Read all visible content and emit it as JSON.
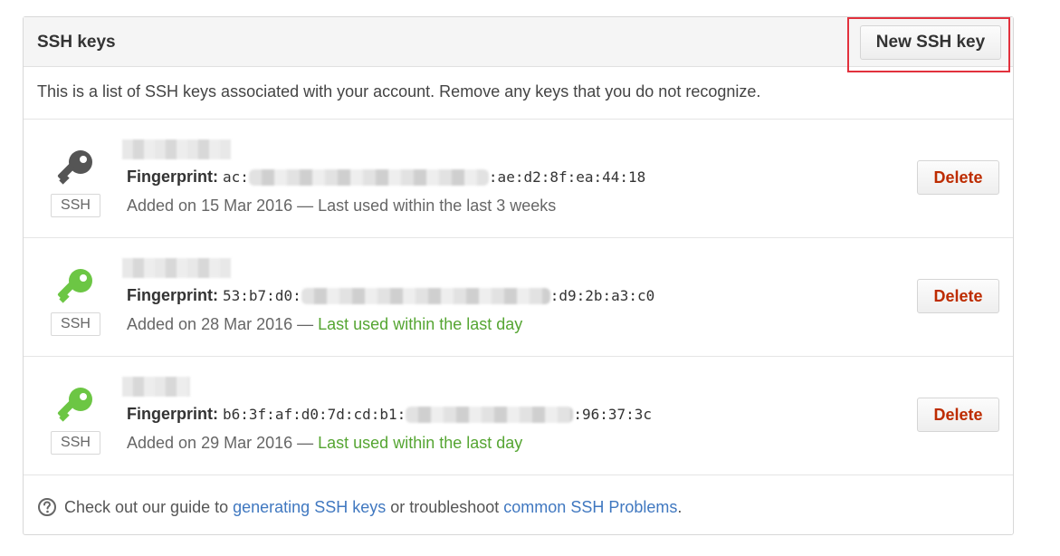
{
  "header": {
    "title": "SSH keys",
    "new_key_label": "New SSH key"
  },
  "intro": "This is a list of SSH keys associated with your account. Remove any keys that you do not recognize.",
  "keys": [
    {
      "badge": "SSH",
      "icon": "key-icon",
      "icon_color": "#555555",
      "fingerprint_label": "Fingerprint:",
      "fingerprint_start": "ac:",
      "fingerprint_end": ":ae:d2:8f:ea:44:18",
      "added": "Added on 15 Mar 2016 — ",
      "last_used": "Last used within the last 3 weeks",
      "recent": false,
      "delete_label": "Delete"
    },
    {
      "badge": "SSH",
      "icon": "key-icon",
      "icon_color": "#6cc644",
      "fingerprint_label": "Fingerprint:",
      "fingerprint_start": "53:b7:d0:",
      "fingerprint_end": ":d9:2b:a3:c0",
      "added": "Added on 28 Mar 2016 — ",
      "last_used": "Last used within the last day",
      "recent": true,
      "delete_label": "Delete"
    },
    {
      "badge": "SSH",
      "icon": "key-icon",
      "icon_color": "#6cc644",
      "fingerprint_label": "Fingerprint:",
      "fingerprint_start": "b6:3f:af:d0:7d:cd:b1:",
      "fingerprint_end": ":96:37:3c",
      "added": "Added on 29 Mar 2016 — ",
      "last_used": "Last used within the last day",
      "recent": true,
      "delete_label": "Delete"
    }
  ],
  "footer": {
    "icon": "question-circle-icon",
    "text_before": "Check out our guide to ",
    "link1": "generating SSH keys",
    "text_middle": " or troubleshoot ",
    "link2": "common SSH Problems",
    "text_after": "."
  },
  "colors": {
    "accent_link": "#4078c0",
    "danger": "#bd2c00",
    "recent_green": "#55a532",
    "highlight_red": "#e2313d"
  }
}
